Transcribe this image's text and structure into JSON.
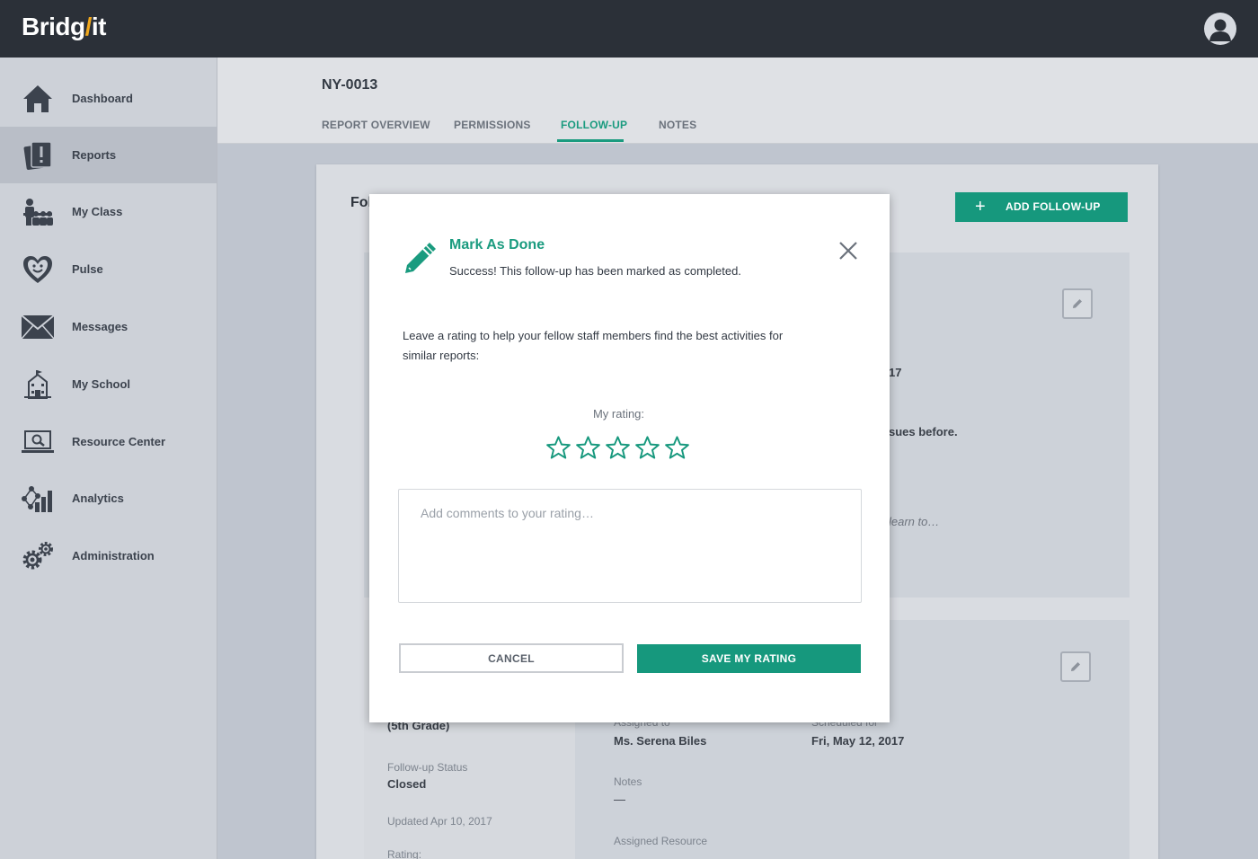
{
  "app": {
    "logo_prefix": "Bridg",
    "logo_mark": "/",
    "logo_suffix": "it"
  },
  "sidebar": {
    "items": [
      {
        "label": "Dashboard",
        "icon": "home-icon"
      },
      {
        "label": "Reports",
        "icon": "reports-icon",
        "active": true
      },
      {
        "label": "My Class",
        "icon": "class-icon"
      },
      {
        "label": "Pulse",
        "icon": "heart-face-icon"
      },
      {
        "label": "Messages",
        "icon": "envelope-icon"
      },
      {
        "label": "My School",
        "icon": "school-icon"
      },
      {
        "label": "Resource Center",
        "icon": "laptop-search-icon"
      },
      {
        "label": "Analytics",
        "icon": "analytics-icon"
      },
      {
        "label": "Administration",
        "icon": "gears-icon"
      }
    ]
  },
  "header": {
    "report_id": "NY-0013",
    "tabs": [
      {
        "label": "REPORT OVERVIEW"
      },
      {
        "label": "PERMISSIONS"
      },
      {
        "label": "FOLLOW-UP",
        "active": true
      },
      {
        "label": "NOTES"
      }
    ]
  },
  "panel": {
    "title_partial": "Fol",
    "add_button": "ADD FOLLOW-UP",
    "card1": {
      "partial_date": "17",
      "partial_text": "sues before.",
      "partial_italic": "learn to…"
    },
    "card2": {
      "grade": "(5th Grade)",
      "status_label": "Follow-up Status",
      "status_value": "Closed",
      "updated": "Updated Apr 10, 2017",
      "rating_label": "Rating:",
      "assigned_label": "Assigned to",
      "assigned_value": "Ms. Serena Biles",
      "scheduled_label": "Scheduled for",
      "scheduled_value": "Fri, May 12, 2017",
      "notes_label": "Notes",
      "notes_value": "—",
      "resource_label": "Assigned Resource"
    }
  },
  "modal": {
    "title": "Mark As Done",
    "subtitle": "Success! This follow-up has been marked as completed.",
    "description": "Leave a rating to help your fellow staff members find the best activities for similar reports:",
    "rating_label": "My rating:",
    "stars": 5,
    "rating_value": 0,
    "comment_placeholder": "Add comments to your rating…",
    "comment_value": "",
    "cancel_label": "CANCEL",
    "save_label": "SAVE MY RATING"
  },
  "colors": {
    "accent": "#16987d",
    "topbar": "#2b3038",
    "logo_mark": "#f0a71c"
  }
}
